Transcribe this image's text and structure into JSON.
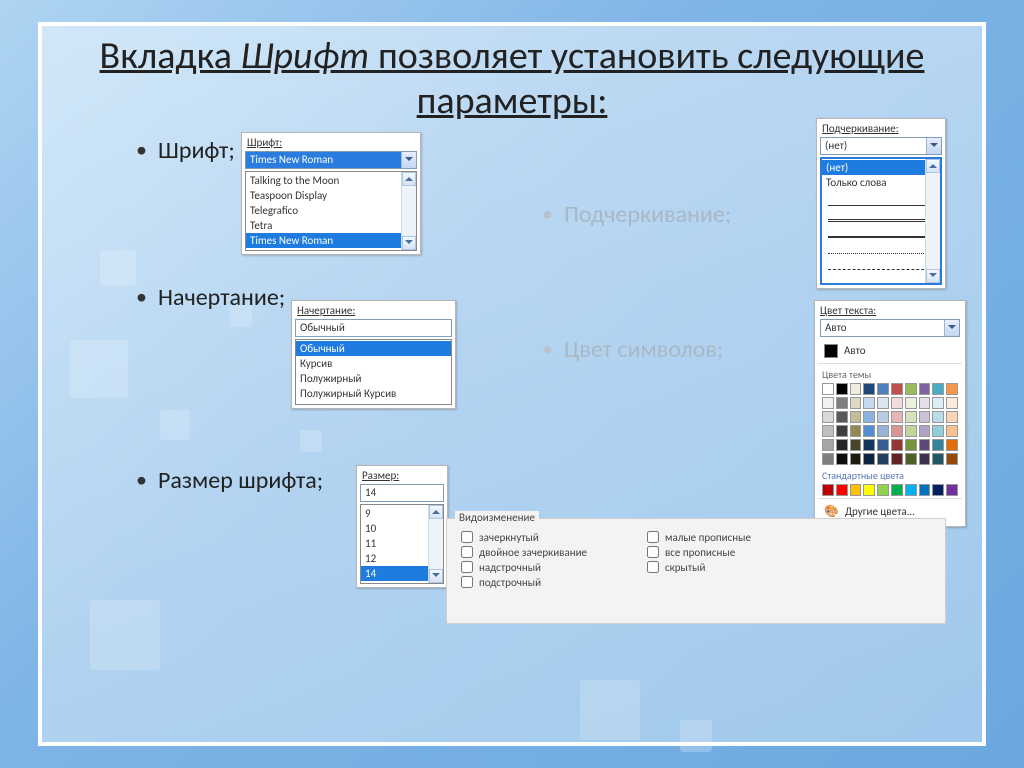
{
  "title_parts": {
    "before": "Вкладка ",
    "italic": "Шрифт",
    "after": " позволяет установить следующие параметры:"
  },
  "left_bullets": [
    "Шрифт;",
    "Начертание;",
    "Размер шрифта;"
  ],
  "right_bullets": [
    "Подчеркивание;",
    "Цвет символов;"
  ],
  "font_panel": {
    "label": "Шрифт:",
    "selected": "Times New Roman",
    "options": [
      "Talking to the Moon",
      "Teaspoon Display",
      "Telegrafico",
      "Tetra",
      "Times New Roman"
    ]
  },
  "style_panel": {
    "label": "Начертание:",
    "selected": "Обычный",
    "options": [
      "Обычный",
      "Курсив",
      "Полужирный",
      "Полужирный Курсив"
    ]
  },
  "size_panel": {
    "label": "Размер:",
    "selected": "14",
    "options": [
      "9",
      "10",
      "11",
      "12",
      "14"
    ]
  },
  "underline_panel": {
    "label": "Подчеркивание:",
    "selected": "(нет)",
    "text_options": [
      "(нет)",
      "Только слова"
    ]
  },
  "color_panel": {
    "label": "Цвет текста:",
    "selected": "Авто",
    "auto_label": "Авто",
    "theme_label": "Цвета темы",
    "standard_label": "Стандартные цвета",
    "more_label": "Другие цвета...",
    "theme_row1": [
      "#ffffff",
      "#000000",
      "#eeece1",
      "#1f497d",
      "#4f81bd",
      "#c0504d",
      "#9bbb59",
      "#8064a2",
      "#4bacc6",
      "#f79646"
    ],
    "theme_row2": [
      "#f2f2f2",
      "#7f7f7f",
      "#ddd9c3",
      "#c6d9f0",
      "#dbe5f1",
      "#f2dbdb",
      "#eaf1dd",
      "#e5dfec",
      "#daeef3",
      "#fde9d9"
    ],
    "theme_row3": [
      "#d8d8d8",
      "#595959",
      "#c4bd97",
      "#8db3e2",
      "#b8cce4",
      "#e5b8b7",
      "#d6e3bc",
      "#ccc0d9",
      "#b6dde8",
      "#fbd5b5"
    ],
    "theme_row4": [
      "#bfbfbf",
      "#3f3f3f",
      "#938953",
      "#548dd4",
      "#95b3d7",
      "#d99594",
      "#c2d69b",
      "#b2a1c7",
      "#92cddc",
      "#fabf8f"
    ],
    "theme_row5": [
      "#a5a5a5",
      "#262626",
      "#494429",
      "#17365d",
      "#365f91",
      "#943634",
      "#76923c",
      "#5f497a",
      "#31849b",
      "#e36c09"
    ],
    "theme_row6": [
      "#7f7f7f",
      "#0c0c0c",
      "#1d1b10",
      "#0f243e",
      "#243f60",
      "#622423",
      "#4f6128",
      "#3f3151",
      "#205867",
      "#974806"
    ],
    "standard": [
      "#c00000",
      "#ff0000",
      "#ffc000",
      "#ffff00",
      "#92d050",
      "#00b050",
      "#00b0f0",
      "#0070c0",
      "#002060",
      "#7030a0"
    ]
  },
  "effects_panel": {
    "legend": "Видоизменение",
    "col1": [
      "зачеркнутый",
      "двойное зачеркивание",
      "надстрочный",
      "подстрочный"
    ],
    "col2": [
      "малые прописные",
      "все прописные",
      "скрытый"
    ]
  }
}
